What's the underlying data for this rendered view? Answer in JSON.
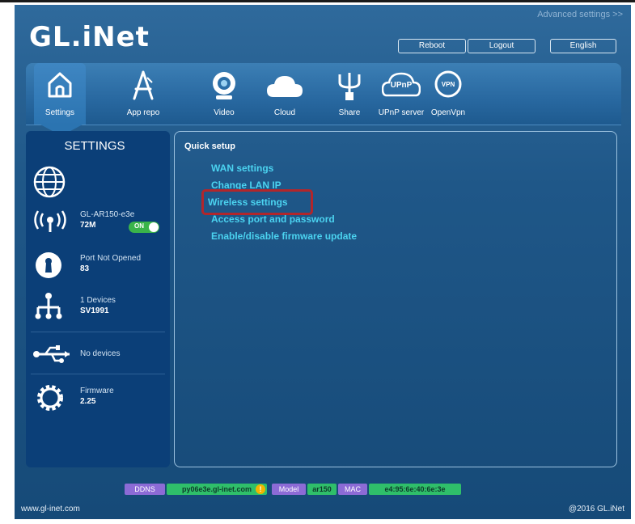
{
  "header": {
    "advanced_link": "Advanced settings >>",
    "logo": "GL.iNet",
    "reboot_label": "Reboot",
    "logout_label": "Logout",
    "language_label": "English"
  },
  "nav": [
    {
      "label": "Settings",
      "icon": "home-icon"
    },
    {
      "label": "App repo",
      "icon": "app-store-icon"
    },
    {
      "label": "Video",
      "icon": "webcam-icon"
    },
    {
      "label": "Cloud",
      "icon": "cloud-icon"
    },
    {
      "label": "Share",
      "icon": "usb-share-icon"
    },
    {
      "label": "UPnP server",
      "icon": "upnp-icon",
      "badge": "UPnP"
    },
    {
      "label": "OpenVpn",
      "icon": "vpn-icon",
      "badge": "VPN"
    }
  ],
  "sidebar": {
    "title": "SETTINGS",
    "wifi": {
      "name": "GL-AR150-e3e",
      "speed": "72M",
      "toggle": "ON"
    },
    "port": {
      "status": "Port Not Opened",
      "number": "83"
    },
    "clients": {
      "count": "1 Devices",
      "name": "SV1991"
    },
    "usb": {
      "status": "No devices"
    },
    "firmware": {
      "label": "Firmware",
      "version": "2.25"
    }
  },
  "main": {
    "title": "Quick setup",
    "links": [
      "WAN settings",
      "Change LAN IP",
      "Wireless settings",
      "Access port and password",
      "Enable/disable firmware update"
    ]
  },
  "status": {
    "ddns_label": "DDNS",
    "ddns_value": "py06e3e.gl-inet.com",
    "warn": "!",
    "model_label": "Model",
    "model_value": "ar150",
    "mac_label": "MAC",
    "mac_value": "e4:95:6e:40:6e:3e"
  },
  "footer": {
    "left": "www.gl-inet.com",
    "right": "@2016 GL.iNet"
  },
  "colors": {
    "link": "#4bd3f0",
    "highlight": "#b2262b",
    "sidebar": "#0b3f78",
    "toggle_on": "#3ab44a"
  }
}
